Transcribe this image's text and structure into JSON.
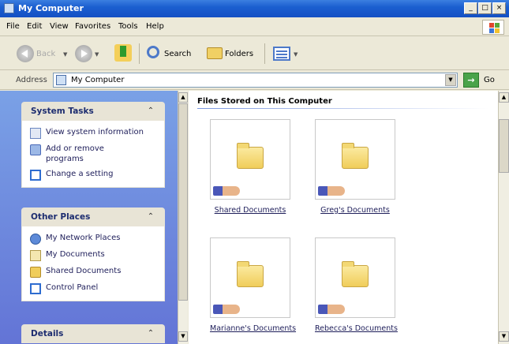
{
  "window": {
    "title": "My Computer",
    "buttons": {
      "minimize": "_",
      "maximize": "□",
      "close": "×"
    }
  },
  "menu": [
    "File",
    "Edit",
    "View",
    "Favorites",
    "Tools",
    "Help"
  ],
  "toolbar": {
    "back": "Back",
    "search": "Search",
    "folders": "Folders"
  },
  "address": {
    "label": "Address",
    "value": "My Computer",
    "go": "Go"
  },
  "taskpane": {
    "system_tasks": {
      "title": "System Tasks",
      "items": [
        "View system information",
        "Add or remove programs",
        "Change a setting"
      ]
    },
    "other_places": {
      "title": "Other Places",
      "items": [
        "My Network Places",
        "My Documents",
        "Shared Documents",
        "Control Panel"
      ]
    },
    "details": {
      "title": "Details"
    }
  },
  "content": {
    "section_title": "Files Stored on This Computer",
    "folders": [
      "Shared Documents",
      "Greg's Documents",
      "Marianne's Documents",
      "Rebecca's Documents"
    ]
  },
  "icons": {
    "collapse": "chevron-up-icon",
    "scroll_up": "▲",
    "scroll_down": "▼",
    "dropdown": "▼"
  }
}
